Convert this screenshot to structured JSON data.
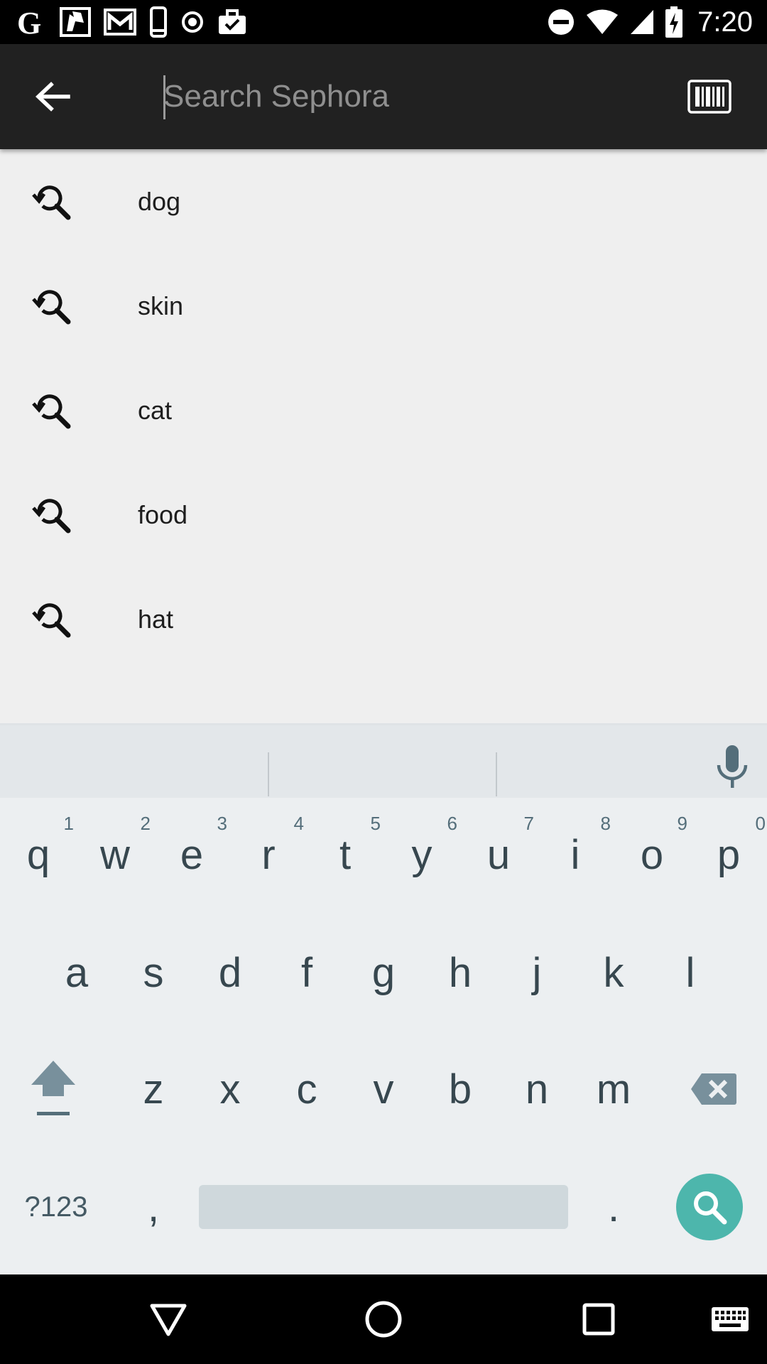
{
  "status_bar": {
    "time": "7:20",
    "left_icons": [
      "google-icon",
      "notes-icon",
      "gmail-icon",
      "phone-icon",
      "record-icon",
      "briefcase-check-icon"
    ],
    "right_icons": [
      "do-not-disturb-icon",
      "wifi-icon",
      "cell-signal-icon",
      "battery-charging-icon"
    ]
  },
  "toolbar": {
    "search_placeholder": "Search Sephora",
    "search_value": ""
  },
  "suggestions": [
    {
      "label": "dog"
    },
    {
      "label": "skin"
    },
    {
      "label": "cat"
    },
    {
      "label": "food"
    },
    {
      "label": "hat"
    }
  ],
  "keyboard": {
    "row1": [
      "q",
      "w",
      "e",
      "r",
      "t",
      "y",
      "u",
      "i",
      "o",
      "p"
    ],
    "row1_hints": [
      "1",
      "2",
      "3",
      "4",
      "5",
      "6",
      "7",
      "8",
      "9",
      "0"
    ],
    "row2": [
      "a",
      "s",
      "d",
      "f",
      "g",
      "h",
      "j",
      "k",
      "l"
    ],
    "row3": [
      "z",
      "x",
      "c",
      "v",
      "b",
      "n",
      "m"
    ],
    "symbols_label": "?123",
    "comma": ",",
    "period": ".",
    "enter_color": "#4db6ac"
  }
}
